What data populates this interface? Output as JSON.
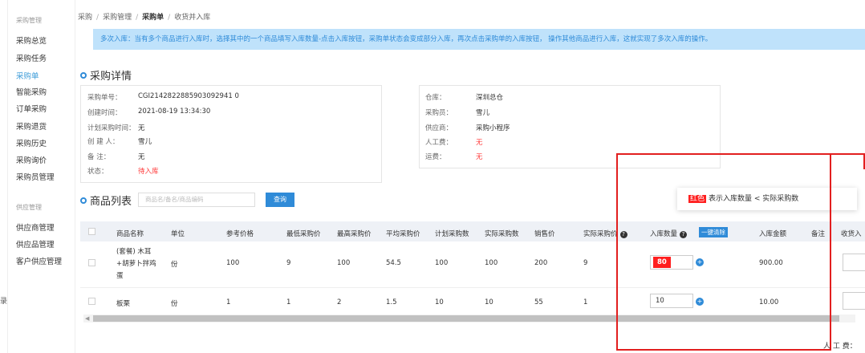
{
  "sidebar": {
    "group_purchase": "采购管理",
    "items": [
      "采购总览",
      "采购任务",
      "采购单",
      "智能采购",
      "订单采购",
      "采购退货",
      "采购历史",
      "采购询价",
      "采购员管理"
    ],
    "active_index": 2,
    "group_supply": "供应管理",
    "supply_items": [
      "供应商管理",
      "供应品管理",
      "客户供应管理"
    ],
    "edge_fragment": "录"
  },
  "breadcrumb": [
    "采购",
    "采购管理",
    "采购单",
    "收货并入库"
  ],
  "tip": "多次入库：当有多个商品进行入库时，选择其中的一个商品填写入库数量-点击入库按钮，采购单状态会变成部分入库，再次点击采购单的入库按钮， 操作其他商品进行入库，这就实现了多次入库的操作。",
  "detail": {
    "title": "采购详情",
    "left": [
      {
        "k": "采购单号：",
        "v": "CGI2142822885903092941 0"
      },
      {
        "k": "创建时间：",
        "v": "2021-08-19 13:34:30"
      },
      {
        "k": "计划采购时间：",
        "v": "无"
      },
      {
        "k": "创 建 人：",
        "v": "雪儿"
      },
      {
        "k": "备 注：",
        "v": "无"
      },
      {
        "k": "状态：",
        "v": "待入库"
      }
    ],
    "right": [
      {
        "k": "仓库：",
        "v": "深圳总仓"
      },
      {
        "k": "采购员：",
        "v": "雪儿"
      },
      {
        "k": "供应商：",
        "v": "采购小程序"
      },
      {
        "k": "人工费：",
        "v": "无"
      },
      {
        "k": "运费：",
        "v": "无"
      }
    ]
  },
  "goods": {
    "title": "商品列表",
    "search_placeholder": "商品名/备名/商品编码",
    "query_label": "查询",
    "columns": [
      "商品名称",
      "单位",
      "参考价格",
      "最低采购价",
      "最高采购价",
      "平均采购价",
      "计划采购数",
      "实际采购数",
      "销售价",
      "实际采购价",
      "入库数量",
      "一键清除",
      "入库金额",
      "备注",
      "收货入"
    ],
    "rows": [
      {
        "name_lines": [
          "(套餐) 木耳",
          "+胡萝卜拌鸡",
          "蛋"
        ],
        "unit": "份",
        "ref": "100",
        "min": "9",
        "max": "100",
        "avg": "54.5",
        "plan": "100",
        "actual": "100",
        "sale": "200",
        "actual_price": "9",
        "qty": "80",
        "amount": "900.00"
      },
      {
        "name_lines": [
          "板栗"
        ],
        "unit": "份",
        "ref": "1",
        "min": "1",
        "max": "2",
        "avg": "1.5",
        "plan": "10",
        "actual": "10",
        "sale": "55",
        "actual_price": "1",
        "qty": "10",
        "amount": "10.00"
      }
    ]
  },
  "popover": {
    "tag": "红色",
    "text": "表示入库数量 < 实际采购数"
  },
  "fee_label": "人 工 费："
}
